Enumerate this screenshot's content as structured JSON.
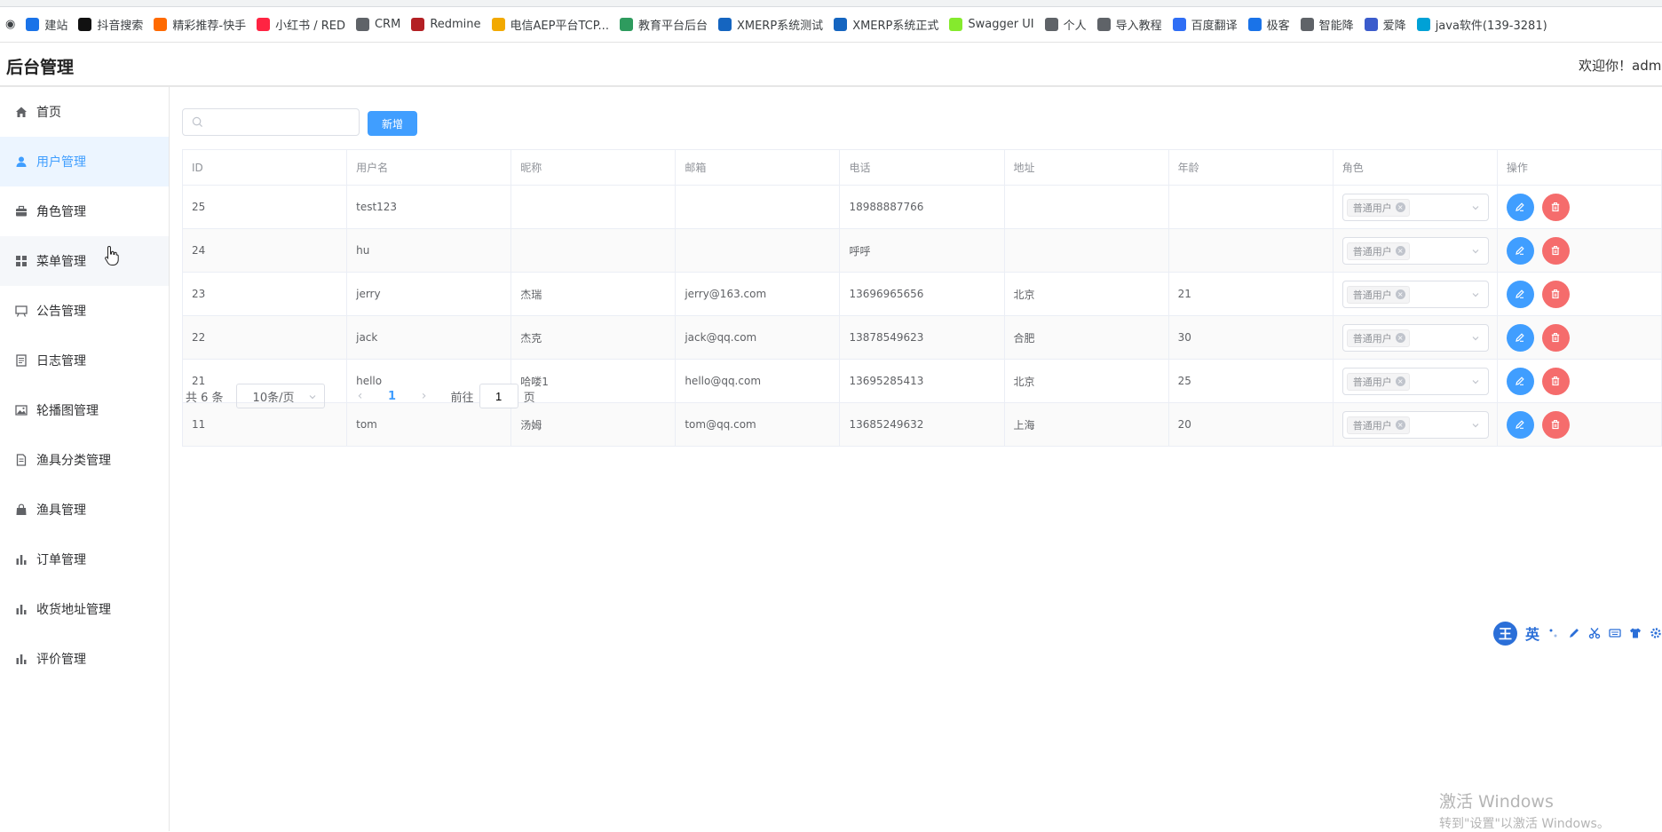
{
  "bookmarks": [
    {
      "label": "建站",
      "color": "#1a73e8",
      "icon": "globe-icon"
    },
    {
      "label": "抖音搜索",
      "color": "#111111",
      "icon": "douyin-icon"
    },
    {
      "label": "精彩推荐-快手",
      "color": "#ff6a00",
      "icon": "kuaishou-icon"
    },
    {
      "label": "小红书 / RED",
      "color": "#ff2442",
      "icon": "xiaohongshu-icon"
    },
    {
      "label": "CRM",
      "color": "#5f6368",
      "icon": "globe-icon"
    },
    {
      "label": "Redmine",
      "color": "#b32024",
      "icon": "redmine-icon"
    },
    {
      "label": "电信AEP平台TCP...",
      "color": "#f2a900",
      "icon": "aep-icon"
    },
    {
      "label": "教育平台后台",
      "color": "#2e9b5e",
      "icon": "leaf-icon"
    },
    {
      "label": "XMERP系统测试",
      "color": "#1565c0",
      "icon": "xm-icon"
    },
    {
      "label": "XMERP系统正式",
      "color": "#1565c0",
      "icon": "xm-icon"
    },
    {
      "label": "Swagger UI",
      "color": "#85ea2d",
      "icon": "swagger-icon"
    },
    {
      "label": "个人",
      "color": "#5f6368",
      "icon": "globe-icon"
    },
    {
      "label": "导入教程",
      "color": "#5f6368",
      "icon": "globe-icon"
    },
    {
      "label": "百度翻译",
      "color": "#2f6ef5",
      "icon": "translate-icon"
    },
    {
      "label": "极客",
      "color": "#1a73e8",
      "icon": "send-icon"
    },
    {
      "label": "智能降",
      "color": "#5f6368",
      "icon": "globe-icon"
    },
    {
      "label": "爱降",
      "color": "#3b5ccc",
      "icon": "ai-icon"
    },
    {
      "label": "java软件(139-3281)",
      "color": "#00a1d6",
      "icon": "bilibili-icon"
    }
  ],
  "header": {
    "title": "后台管理",
    "welcome": "欢迎你！admin"
  },
  "sidebar": {
    "items": [
      {
        "label": "首页",
        "icon": "home-icon"
      },
      {
        "label": "用户管理",
        "icon": "user-icon",
        "active": true
      },
      {
        "label": "角色管理",
        "icon": "briefcase-icon"
      },
      {
        "label": "菜单管理",
        "icon": "menu-grid-icon"
      },
      {
        "label": "公告管理",
        "icon": "notice-board-icon"
      },
      {
        "label": "日志管理",
        "icon": "log-icon"
      },
      {
        "label": "轮播图管理",
        "icon": "picture-icon"
      },
      {
        "label": "渔具分类管理",
        "icon": "document-icon"
      },
      {
        "label": "渔具管理",
        "icon": "bag-icon"
      },
      {
        "label": "订单管理",
        "icon": "bar-chart-icon"
      },
      {
        "label": "收货地址管理",
        "icon": "bar-chart-icon"
      },
      {
        "label": "评价管理",
        "icon": "bar-chart-icon"
      }
    ]
  },
  "toolbar": {
    "search_placeholder": "",
    "add_label": "新增"
  },
  "table": {
    "columns": [
      "ID",
      "用户名",
      "昵称",
      "邮箱",
      "电话",
      "地址",
      "年龄",
      "角色",
      "操作"
    ],
    "rows": [
      {
        "id": "25",
        "username": "test123",
        "nickname": "",
        "email": "",
        "phone": "18988887766",
        "address": "",
        "age": "",
        "role": "普通用户"
      },
      {
        "id": "24",
        "username": "hu",
        "nickname": "",
        "email": "",
        "phone": "呼呼",
        "address": "",
        "age": "",
        "role": "普通用户"
      },
      {
        "id": "23",
        "username": "jerry",
        "nickname": "杰瑞",
        "email": "jerry@163.com",
        "phone": "13696965656",
        "address": "北京",
        "age": "21",
        "role": "普通用户"
      },
      {
        "id": "22",
        "username": "jack",
        "nickname": "杰克",
        "email": "jack@qq.com",
        "phone": "13878549623",
        "address": "合肥",
        "age": "30",
        "role": "普通用户"
      },
      {
        "id": "21",
        "username": "hello",
        "nickname": "哈喽1",
        "email": "hello@qq.com",
        "phone": "13695285413",
        "address": "北京",
        "age": "25",
        "role": "普通用户"
      },
      {
        "id": "11",
        "username": "tom",
        "nickname": "汤姆",
        "email": "tom@qq.com",
        "phone": "13685249632",
        "address": "上海",
        "age": "20",
        "role": "普通用户"
      }
    ]
  },
  "pagination": {
    "total": "共 6 条",
    "page_size": "10条/页",
    "current_page": "1",
    "goto_label": "前往",
    "goto_value": "1",
    "page_word": "页"
  },
  "ime": {
    "logo": "王",
    "lang": "英"
  },
  "watermark": {
    "line1": "激活 Windows",
    "line2": "转到\"设置\"以激活 Windows。"
  },
  "colors": {
    "primary": "#409eff",
    "danger": "#f56c6c",
    "active_bg": "#ecf5ff"
  }
}
